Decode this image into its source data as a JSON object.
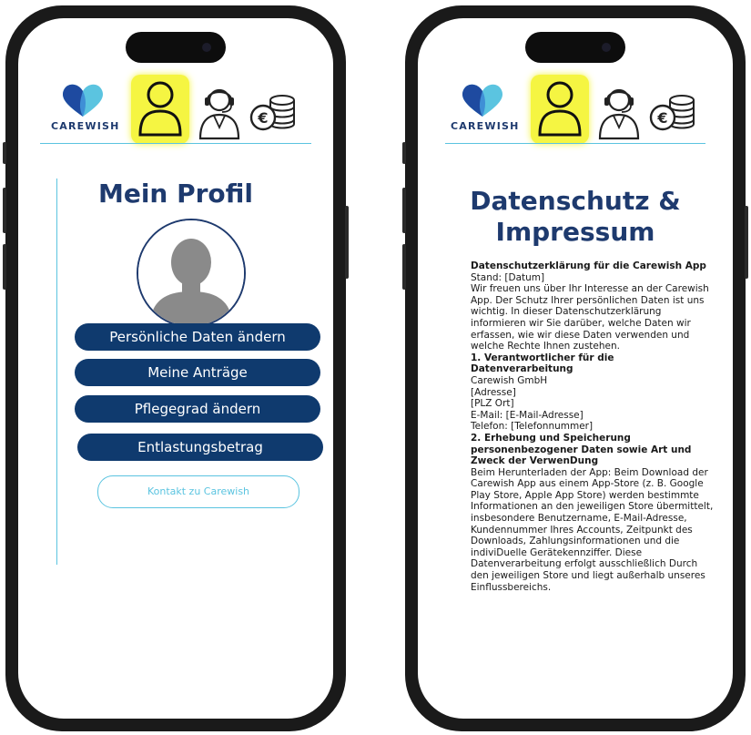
{
  "brand": {
    "name": "CAREWISH"
  },
  "header_icons": {
    "logo": "carewish-heart-logo",
    "profile": "user-profile-icon",
    "support": "support-agent-icon",
    "finance": "euro-coins-icon",
    "active_highlight_color": "#f5f542"
  },
  "colors": {
    "primary": "#0f3a6e",
    "accent": "#5bc4e0",
    "title": "#1e3a6e"
  },
  "profile_screen": {
    "title": "Mein Profil",
    "buttons": [
      {
        "label": "Persönliche Daten ändern"
      },
      {
        "label": "Meine Anträge"
      },
      {
        "label": "Pflegegrad ändern"
      },
      {
        "label": "Entlastungsbetrag"
      }
    ],
    "contact_button": "Kontakt zu Carewish"
  },
  "privacy_screen": {
    "title_line1": "Datenschutz &",
    "title_line2": "Impressum",
    "heading": "Datenschutzerklärung für die Carewish App",
    "stand": "Stand: [Datum]",
    "intro": "Wir freuen uns über Ihr Interesse an der Carewish App. Der Schutz Ihrer persönlichen Daten ist uns wichtig. In dieser Datenschutzerklärung informieren wir Sie darüber, welche Daten wir erfassen, wie wir diese Daten verwenden und welche Rechte Ihnen zustehen.",
    "section1_title": "1. Verantwortlicher für die Datenverarbeitung",
    "company": "Carewish GmbH",
    "address": "[Adresse]",
    "city": "[PLZ Ort]",
    "email": "E-Mail: [E-Mail-Adresse]",
    "phone": "Telefon: [Telefonnummer]",
    "section2_title": "2. Erhebung und Speicherung personenbezogener Daten sowie Art und Zweck der VerwenDung",
    "section2_text": "Beim Herunterladen der App: Beim Download der Carewish App aus einem App-Store (z. B. Google Play Store, Apple App Store) werden bestimmte Informationen an den jeweiligen Store übermittelt, insbesondere Benutzername, E-Mail-Adresse, Kundennummer Ihres Accounts, Zeitpunkt des Downloads, Zahlungsinformationen und die indiviDuelle Gerätekennziffer. Diese Datenverarbeitung erfolgt ausschließlich Durch den jeweiligen Store und liegt außerhalb unseres Einflussbereichs."
  }
}
